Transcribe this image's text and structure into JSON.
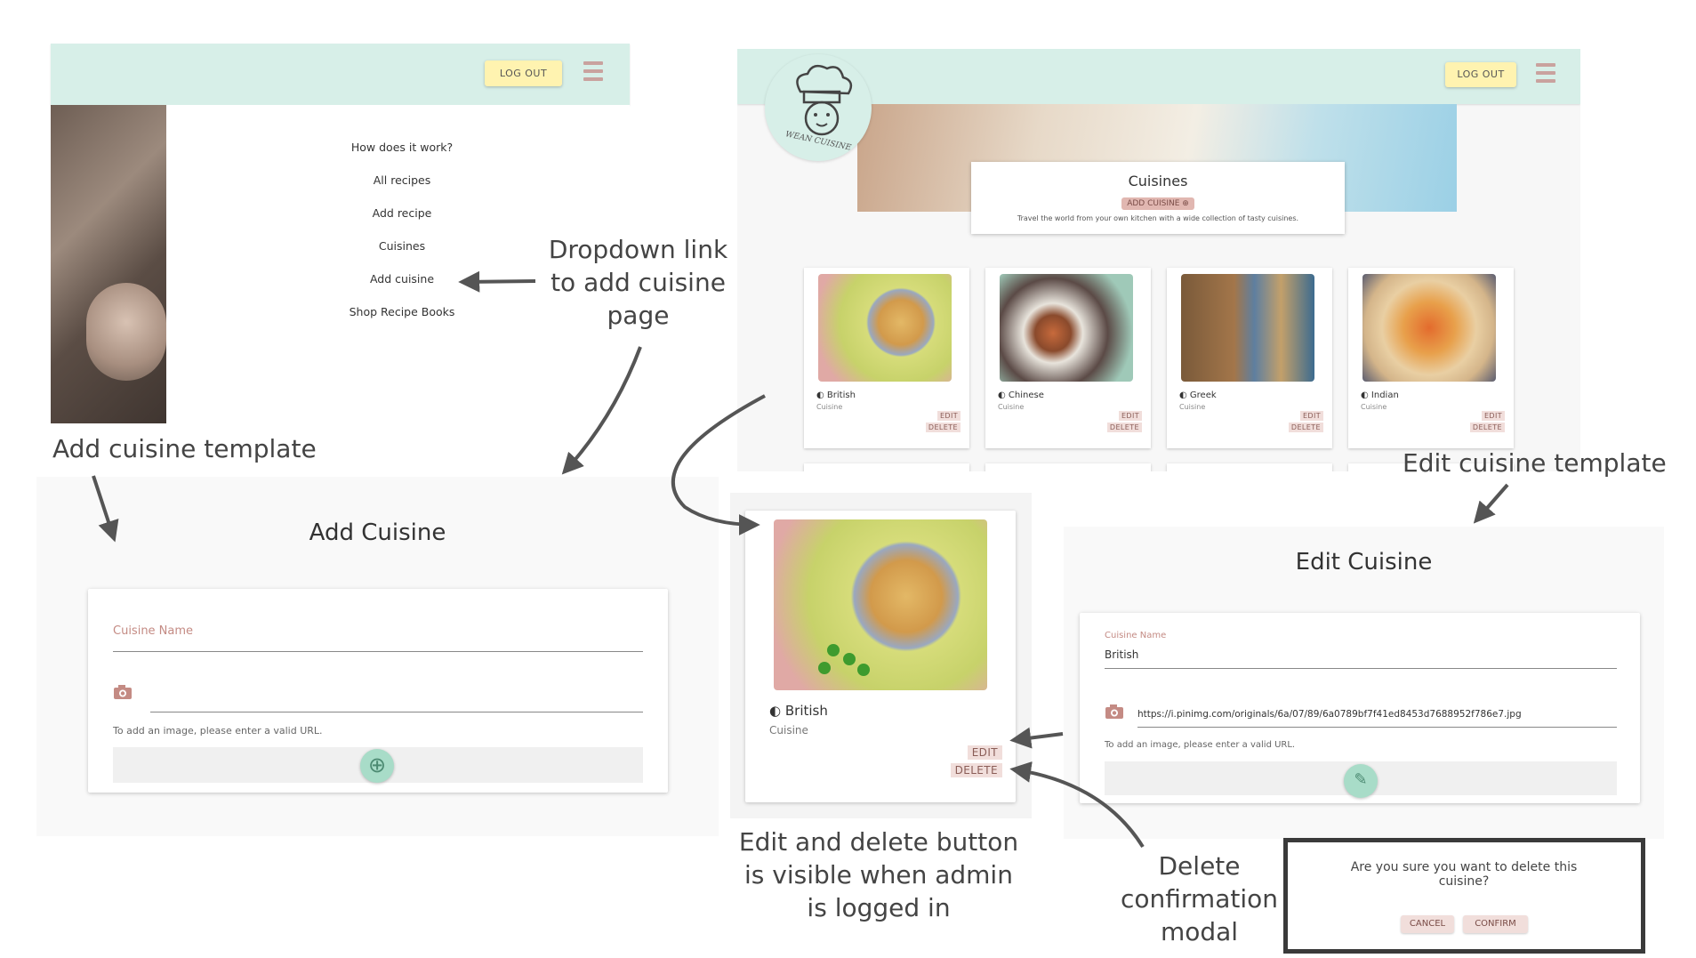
{
  "dropdown_panel": {
    "logout_label": "LOG OUT",
    "menu_items": [
      "How does it work?",
      "All recipes",
      "Add recipe",
      "Cuisines",
      "Add cuisine",
      "Shop Recipe Books"
    ]
  },
  "cuisines_page": {
    "logo_text": "WEAN CUISINE",
    "logout_label": "LOG OUT",
    "hero_title": "Cuisines",
    "add_cuisine_label": "ADD CUISINE ⊕",
    "hero_subtitle": "Travel the world from your own kitchen with a wide collection of tasty cuisines.",
    "cards": [
      {
        "name": "British",
        "sub": "Cuisine",
        "edit": "EDIT",
        "delete": "DELETE"
      },
      {
        "name": "Chinese",
        "sub": "Cuisine",
        "edit": "EDIT",
        "delete": "DELETE"
      },
      {
        "name": "Greek",
        "sub": "Cuisine",
        "edit": "EDIT",
        "delete": "DELETE"
      },
      {
        "name": "Indian",
        "sub": "Cuisine",
        "edit": "EDIT",
        "delete": "DELETE"
      }
    ]
  },
  "add_form": {
    "title": "Add Cuisine",
    "name_label": "Cuisine Name",
    "helper": "To add an image, please enter a valid URL."
  },
  "card_zoom": {
    "name": "British",
    "sub": "Cuisine",
    "edit": "EDIT",
    "delete": "DELETE"
  },
  "edit_form": {
    "title": "Edit Cuisine",
    "name_label": "Cuisine Name",
    "name_value": "British",
    "url_value": "https://i.pinimg.com/originals/6a/07/89/6a0789bf7f41ed8453d7688952f786e7.jpg",
    "helper": "To add an image, please enter a valid URL."
  },
  "modal": {
    "message": "Are you sure you want to delete this cuisine?",
    "cancel": "CANCEL",
    "confirm": "CONFIRM"
  },
  "annotations": {
    "dropdown_link": "Dropdown link to add cuisine page",
    "add_template": "Add cuisine template",
    "edit_template": "Edit cuisine template",
    "edit_delete_visible": "Edit and delete button is visible when admin is logged in",
    "delete_modal": "Delete confirmation modal"
  },
  "colors": {
    "navbar": "#d7efe8",
    "logout_button": "#fff3b0",
    "accent_pink": "#c48b84",
    "fab_green": "#a8dcc8"
  }
}
